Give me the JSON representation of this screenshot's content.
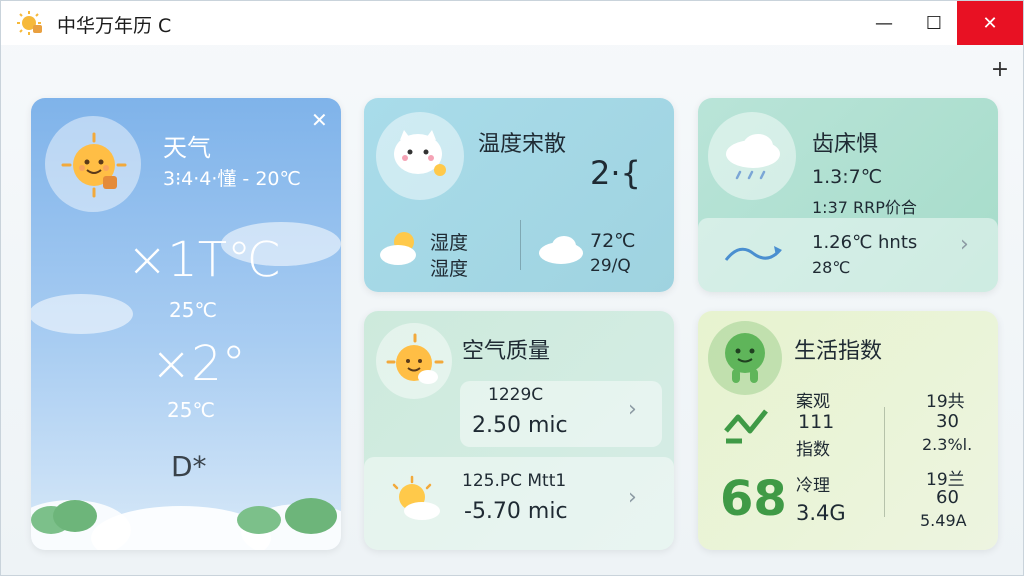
{
  "window": {
    "title": "中华万年历 C",
    "minimize_label": "—",
    "maximize_label": "☐",
    "close_label": "✕",
    "add_label": "+"
  },
  "weather": {
    "title": "天气",
    "close_label": "✕",
    "range": "3⁝4·4·懂 - 20℃",
    "temp_main": "×1T℃",
    "temp_sub": "25℃",
    "temp_second": "×2°",
    "temp_second_sub": "25℃",
    "moon_text": "D*"
  },
  "humidity": {
    "title": "温度宋散",
    "value": "2·{",
    "row_label_1": "湿度",
    "row_label_2": "湿度",
    "right_value": "72℃",
    "right_sub": "29/Q"
  },
  "rain": {
    "title": "齿床惧",
    "line1": "1.3:7℃",
    "line2": "1:37 RRP价合",
    "wind_value": "1.26℃ hnts",
    "wind_sub": "28℃"
  },
  "air": {
    "title": "空气质量",
    "row1_label": "1229C",
    "row1_value": "2.50 mic",
    "row2_label": "125.PC Mtt1",
    "row2_value": "-5.70 mic"
  },
  "life": {
    "title": "生活指数",
    "col1_label": "案观",
    "col1_value": "111",
    "col1_sub": "指数",
    "col2_label": "19共",
    "col2_value": "30",
    "col2_sub": "2.3%l.",
    "big_number": "68",
    "row2_label": "冷理",
    "row2_value": "3.4G",
    "col3_label": "19兰",
    "col3_value": "60",
    "col3_sub": "5.49A"
  },
  "colors": {
    "close_red": "#e81123",
    "life_green": "#3f9a46"
  }
}
